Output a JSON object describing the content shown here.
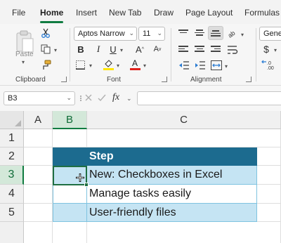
{
  "tabs": [
    {
      "label": "File",
      "active": false
    },
    {
      "label": "Home",
      "active": true
    },
    {
      "label": "Insert",
      "active": false
    },
    {
      "label": "New Tab",
      "active": false
    },
    {
      "label": "Draw",
      "active": false
    },
    {
      "label": "Page Layout",
      "active": false
    },
    {
      "label": "Formulas",
      "active": false
    }
  ],
  "ribbon": {
    "clipboard": {
      "label": "Clipboard",
      "paste_label": "Paste"
    },
    "font": {
      "label": "Font",
      "font_name": "Aptos Narrow",
      "font_size": "11",
      "bold": "B",
      "italic": "I",
      "underline": "U",
      "grow": "A",
      "shrink": "A"
    },
    "alignment": {
      "label": "Alignment"
    },
    "number": {
      "format": "Genera",
      "currency": "$"
    }
  },
  "formula_bar": {
    "name_box": "B3",
    "fx": "fx",
    "formula": ""
  },
  "grid": {
    "columns": [
      "A",
      "B",
      "C"
    ],
    "rows": [
      "1",
      "2",
      "3",
      "4",
      "5"
    ],
    "selected_cell": "B3",
    "cells": {
      "C2": "Step",
      "C3": "New: Checkboxes in Excel",
      "C4": "Manage tasks easily",
      "C5": "User-friendly files"
    }
  },
  "colors": {
    "accent": "#107c41",
    "table_header": "#1c6b8f",
    "table_band": "#c5e4f3"
  }
}
